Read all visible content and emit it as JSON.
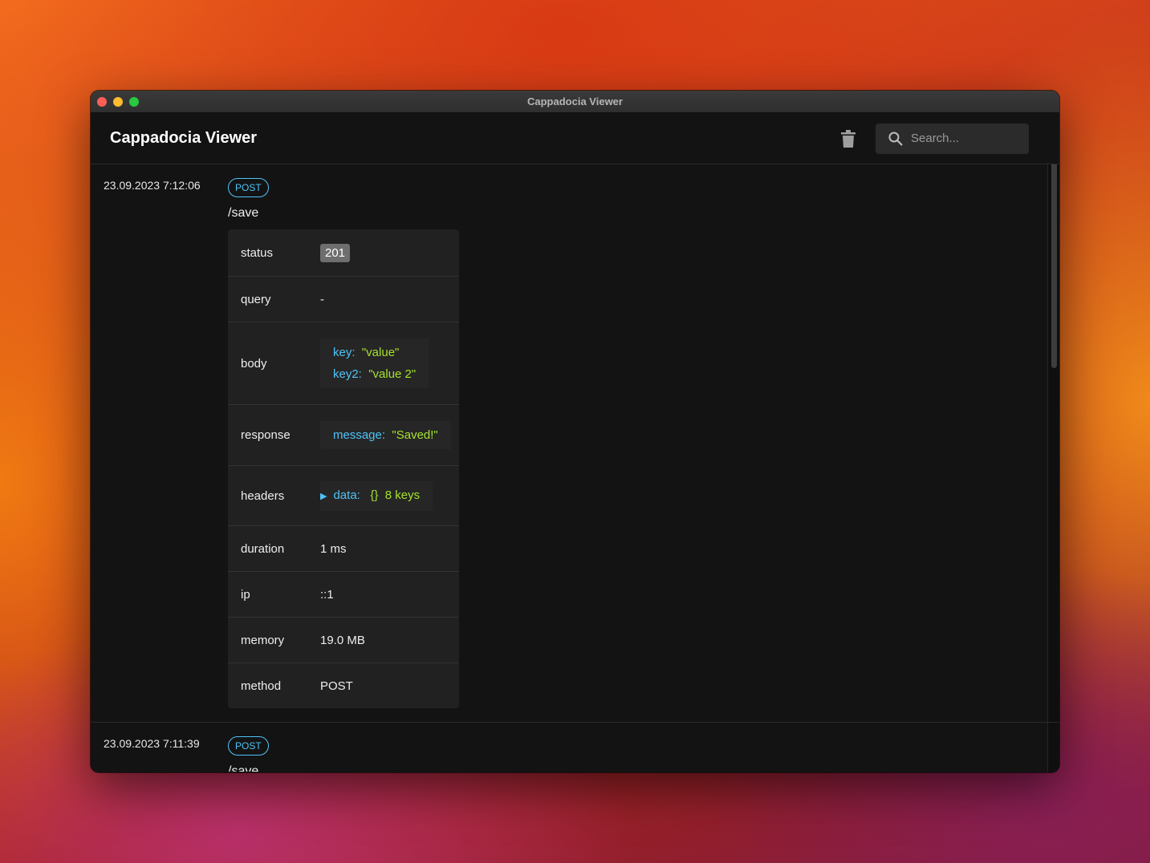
{
  "window": {
    "title": "Cappadocia Viewer"
  },
  "header": {
    "title": "Cappadocia Viewer",
    "search_placeholder": "Search..."
  },
  "entries": [
    {
      "timestamp": "23.09.2023 7:12:06",
      "method_chip": "POST",
      "path": "/save",
      "details": {
        "status_label": "status",
        "status_value": "201",
        "query_label": "query",
        "query_value": "-",
        "body_label": "body",
        "body": [
          {
            "key": "key:",
            "value": "\"value\""
          },
          {
            "key": "key2:",
            "value": "\"value 2\""
          }
        ],
        "response_label": "response",
        "response": {
          "key": "message:",
          "value": "\"Saved!\""
        },
        "headers_label": "headers",
        "headers": {
          "key": "data:",
          "brace": "{}",
          "count": "8 keys"
        },
        "duration_label": "duration",
        "duration_value": "1 ms",
        "ip_label": "ip",
        "ip_value": "::1",
        "memory_label": "memory",
        "memory_value": "19.0 MB",
        "method_label": "method",
        "method_value": "POST"
      }
    },
    {
      "timestamp": "23.09.2023 7:11:39",
      "method_chip": "POST",
      "path": "/save"
    }
  ]
}
